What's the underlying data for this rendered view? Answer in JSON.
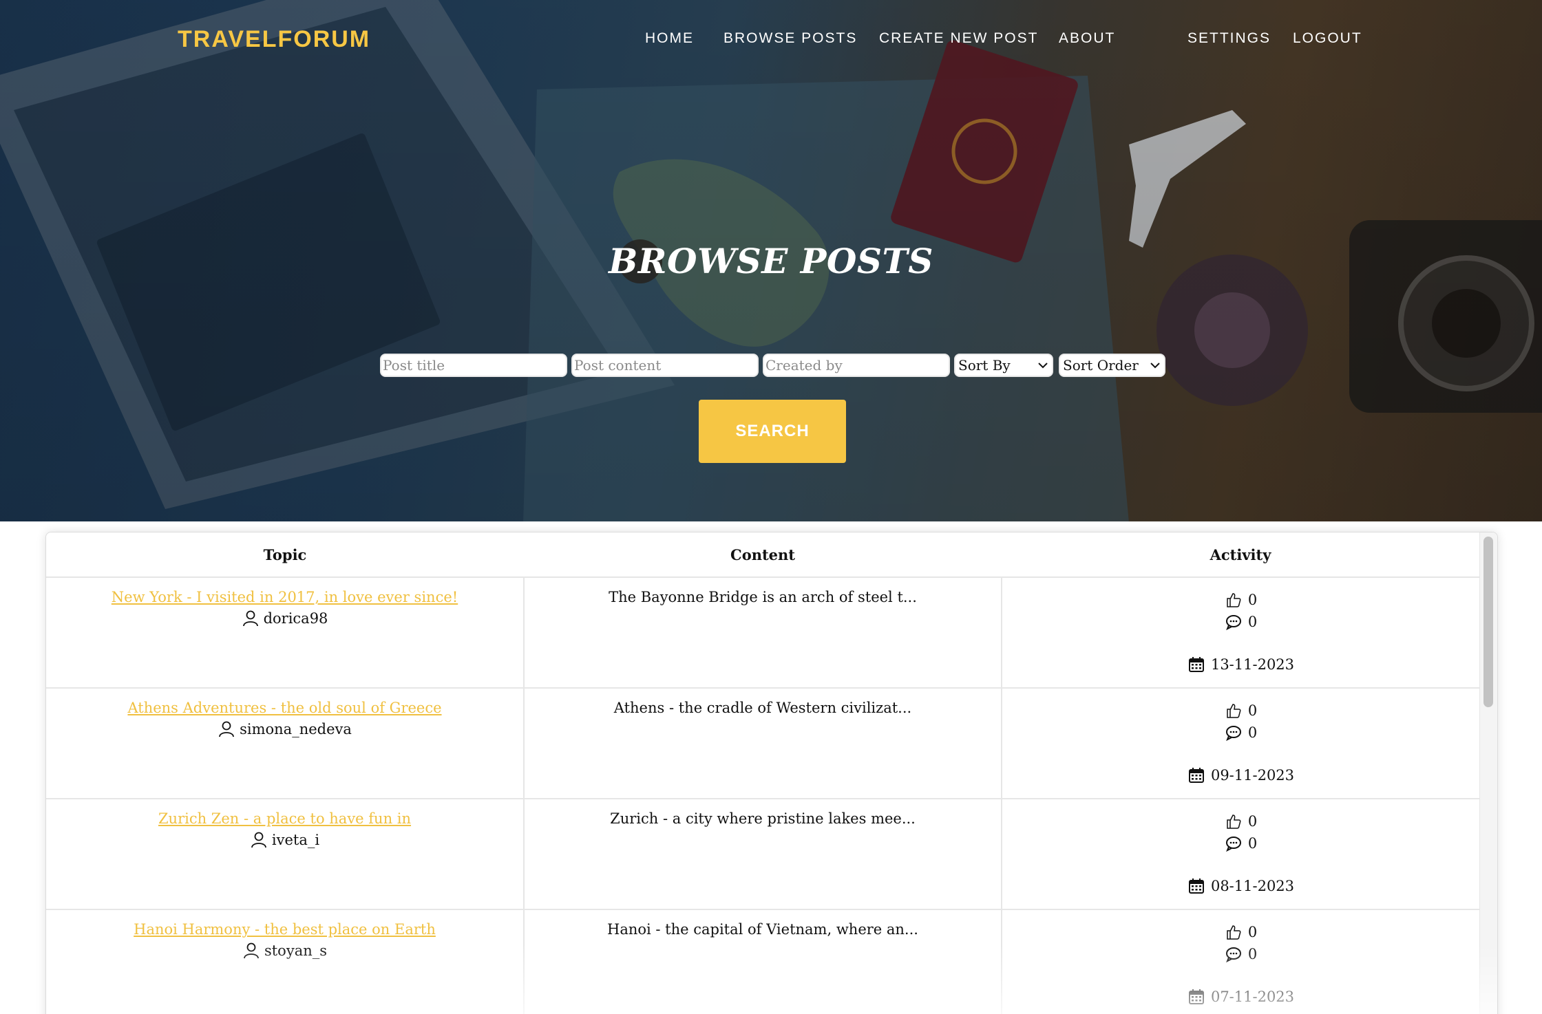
{
  "brand": "TRAVELFORUM",
  "nav": {
    "home": "HOME",
    "browse": "BROWSE POSTS",
    "create": "CREATE NEW POST",
    "about": "ABOUT",
    "settings": "SETTINGS",
    "logout": "LOGOUT"
  },
  "hero": {
    "title": "BROWSE POSTS"
  },
  "filters": {
    "title_placeholder": "Post title",
    "content_placeholder": "Post content",
    "created_by_placeholder": "Created by",
    "sort_by": "Sort By",
    "sort_order": "Sort Order",
    "search_label": "SEARCH"
  },
  "table": {
    "headers": {
      "topic": "Topic",
      "content": "Content",
      "activity": "Activity"
    },
    "rows": [
      {
        "title": "New York - I visited in 2017, in love ever since!",
        "author": "dorica98",
        "content": "The Bayonne Bridge is an arch of steel t...",
        "likes": "0",
        "comments": "0",
        "date": "13-11-2023"
      },
      {
        "title": "Athens Adventures - the old soul of Greece",
        "author": "simona_nedeva",
        "content": "Athens - the cradle of Western civilizat...",
        "likes": "0",
        "comments": "0",
        "date": "09-11-2023"
      },
      {
        "title": "Zurich Zen - a place to have fun in",
        "author": "iveta_i",
        "content": "Zurich - a city where pristine lakes mee...",
        "likes": "0",
        "comments": "0",
        "date": "08-11-2023"
      },
      {
        "title": "Hanoi Harmony - the best place on Earth",
        "author": "stoyan_s",
        "content": "Hanoi - the capital of Vietnam, where an...",
        "likes": "0",
        "comments": "0",
        "date": "07-11-2023"
      }
    ]
  },
  "colors": {
    "accent": "#f6c644",
    "link": "#f0c040",
    "brand": "#f7c744"
  },
  "icons": [
    "user-icon",
    "thumbs-up-icon",
    "comment-icon",
    "calendar-icon",
    "chevron-down-icon"
  ]
}
